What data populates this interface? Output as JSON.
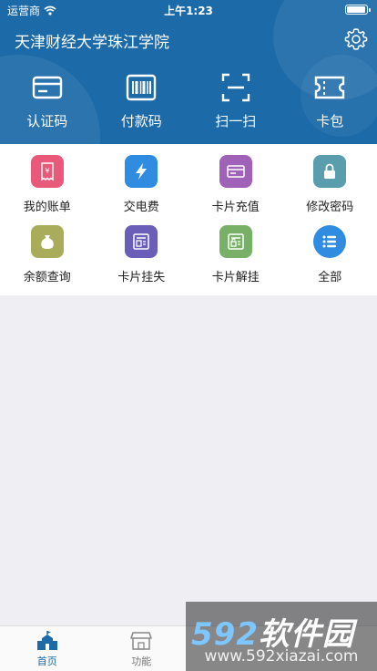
{
  "status_bar": {
    "carrier": "运营商",
    "time": "上午1:23",
    "battery_level": 0.95
  },
  "header": {
    "title": "天津财经大学珠江学院",
    "settings_icon": "gear-icon"
  },
  "quick_actions": [
    {
      "label": "认证码",
      "icon": "card-icon"
    },
    {
      "label": "付款码",
      "icon": "barcode-icon"
    },
    {
      "label": "扫一扫",
      "icon": "scan-icon"
    },
    {
      "label": "卡包",
      "icon": "ticket-icon"
    }
  ],
  "grid_items": [
    {
      "label": "我的账单",
      "icon": "bill-icon",
      "color": "#e8597a"
    },
    {
      "label": "交电费",
      "icon": "lightning-icon",
      "color": "#2f8ce0"
    },
    {
      "label": "卡片充值",
      "icon": "card-recharge-icon",
      "color": "#a062b8"
    },
    {
      "label": "修改密码",
      "icon": "lock-icon",
      "color": "#5a9eae"
    },
    {
      "label": "余额查询",
      "icon": "money-bag-icon",
      "color": "#a9ad5b"
    },
    {
      "label": "卡片挂失",
      "icon": "card-lost-icon",
      "color": "#6a5eb8"
    },
    {
      "label": "卡片解挂",
      "icon": "card-unlock-icon",
      "color": "#78b068"
    },
    {
      "label": "全部",
      "icon": "list-icon",
      "color": "#2f8ce0"
    }
  ],
  "tab_bar": [
    {
      "label": "首页",
      "icon": "school-icon",
      "active": true
    },
    {
      "label": "功能",
      "icon": "store-icon",
      "active": false
    },
    {
      "label": "",
      "icon": "",
      "active": false
    },
    {
      "label": "",
      "icon": "",
      "active": false
    }
  ],
  "watermark": {
    "brand_num": "592",
    "brand_text": "软件园",
    "url": "www.592xiazai.com"
  }
}
